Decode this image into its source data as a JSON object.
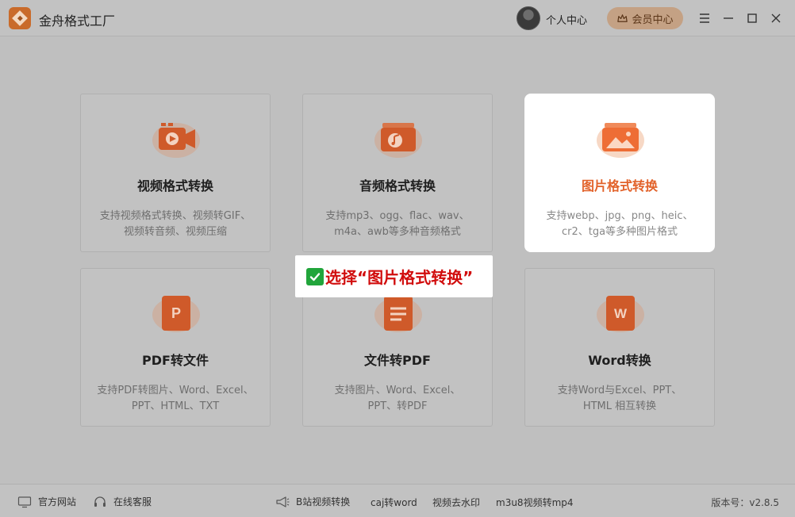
{
  "app": {
    "title": "金舟格式工厂"
  },
  "header": {
    "user_center": "个人中心",
    "vip_label": "会员中心"
  },
  "cards": [
    {
      "title": "视频格式转换",
      "desc_line1": "支持视频格式转换、视频转GIF、",
      "desc_line2": "视频转音频、视频压缩",
      "icon": "video-icon"
    },
    {
      "title": "音频格式转换",
      "desc_line1": "支持mp3、ogg、flac、wav、",
      "desc_line2": "m4a、awb等多种音频格式",
      "icon": "audio-icon"
    },
    {
      "title": "图片格式转换",
      "desc_line1": "支持webp、jpg、png、heic、",
      "desc_line2": "cr2、tga等多种图片格式",
      "icon": "image-icon",
      "selected": true
    },
    {
      "title": "PDF转文件",
      "desc_line1": "支持PDF转图片、Word、Excel、",
      "desc_line2": "PPT、HTML、TXT",
      "icon": "pdf-icon"
    },
    {
      "title": "文件转PDF",
      "desc_line1": "支持图片、Word、Excel、",
      "desc_line2": "PPT、转PDF",
      "icon": "doc-icon"
    },
    {
      "title": "Word转换",
      "desc_line1": "支持Word与Excel、PPT、",
      "desc_line2": "HTML 相互转换",
      "icon": "word-icon"
    }
  ],
  "callout": {
    "text": "选择“图片格式转换”"
  },
  "footer": {
    "website": "官方网站",
    "support": "在线客服",
    "bilibili": "B站视频转换",
    "caj": "caj转word",
    "watermark": "视频去水印",
    "m3u8": "m3u8视频转mp4",
    "version": "版本号：v2.8.5"
  },
  "colors": {
    "accent": "#e2622a",
    "callout_text": "#d10d0d",
    "overlay_bg": "#bfbfbf"
  }
}
